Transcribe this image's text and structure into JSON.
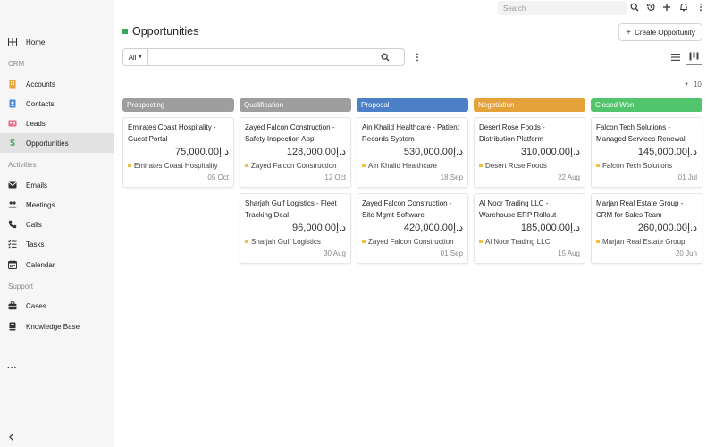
{
  "topbar": {
    "search_placeholder": "Search"
  },
  "sidebar": {
    "home": "Home",
    "crm_label": "CRM",
    "accounts": "Accounts",
    "contacts": "Contacts",
    "leads": "Leads",
    "opportunities": "Opportunities",
    "activities_label": "Activities",
    "emails": "Emails",
    "meetings": "Meetings",
    "calls": "Calls",
    "tasks": "Tasks",
    "calendar": "Calendar",
    "support_label": "Support",
    "cases": "Cases",
    "knowledge_base": "Knowledge Base",
    "more": "..."
  },
  "header": {
    "title": "Opportunities",
    "create_label": "Create Opportunity"
  },
  "filter": {
    "select_value": "All"
  },
  "page_size": "10",
  "columns": [
    {
      "label": "Prospecting",
      "color": "#9e9e9e"
    },
    {
      "label": "Qualification",
      "color": "#9e9e9e"
    },
    {
      "label": "Proposal",
      "color": "#4b7fc6"
    },
    {
      "label": "Negotiation",
      "color": "#e5a23a"
    },
    {
      "label": "Closed Won",
      "color": "#52c46c"
    }
  ],
  "cards": [
    [
      {
        "title": "Emirates Coast Hospitality - Guest Portal",
        "amount": "75,000.00د.إ",
        "account": "Emirates Coast Hospitality",
        "date": "05 Oct"
      }
    ],
    [
      {
        "title": "Zayed Falcon Construction - Safety Inspection App",
        "amount": "128,000.00د.إ",
        "account": "Zayed Falcon Construction",
        "date": "12 Oct"
      },
      {
        "title": "Sharjah Gulf Logistics - Fleet Tracking Deal",
        "amount": "96,000.00د.إ",
        "account": "Sharjah Gulf Logistics",
        "date": "30 Aug"
      }
    ],
    [
      {
        "title": "Ain Khalid Healthcare - Patient Records System",
        "amount": "530,000.00د.إ",
        "account": "Ain Khalid Healthcare",
        "date": "18 Sep"
      },
      {
        "title": "Zayed Falcon Construction - Site Mgmt Software",
        "amount": "420,000.00د.إ",
        "account": "Zayed Falcon Construction",
        "date": "01 Sep"
      }
    ],
    [
      {
        "title": "Desert Rose Foods - Distribution Platform",
        "amount": "310,000.00د.إ",
        "account": "Desert Rose Foods",
        "date": "22 Aug"
      },
      {
        "title": "Al Noor Trading LLC - Warehouse ERP Rollout",
        "amount": "185,000.00د.إ",
        "account": "Al Noor Trading LLC",
        "date": "15 Aug"
      }
    ],
    [
      {
        "title": "Falcon Tech Solutions - Managed Services Renewal",
        "amount": "145,000.00د.إ",
        "account": "Falcon Tech Solutions",
        "date": "01 Jul"
      },
      {
        "title": "Marjan Real Estate Group - CRM for Sales Team",
        "amount": "260,000.00د.إ",
        "account": "Marjan Real Estate Group",
        "date": "20 Jun"
      }
    ]
  ]
}
